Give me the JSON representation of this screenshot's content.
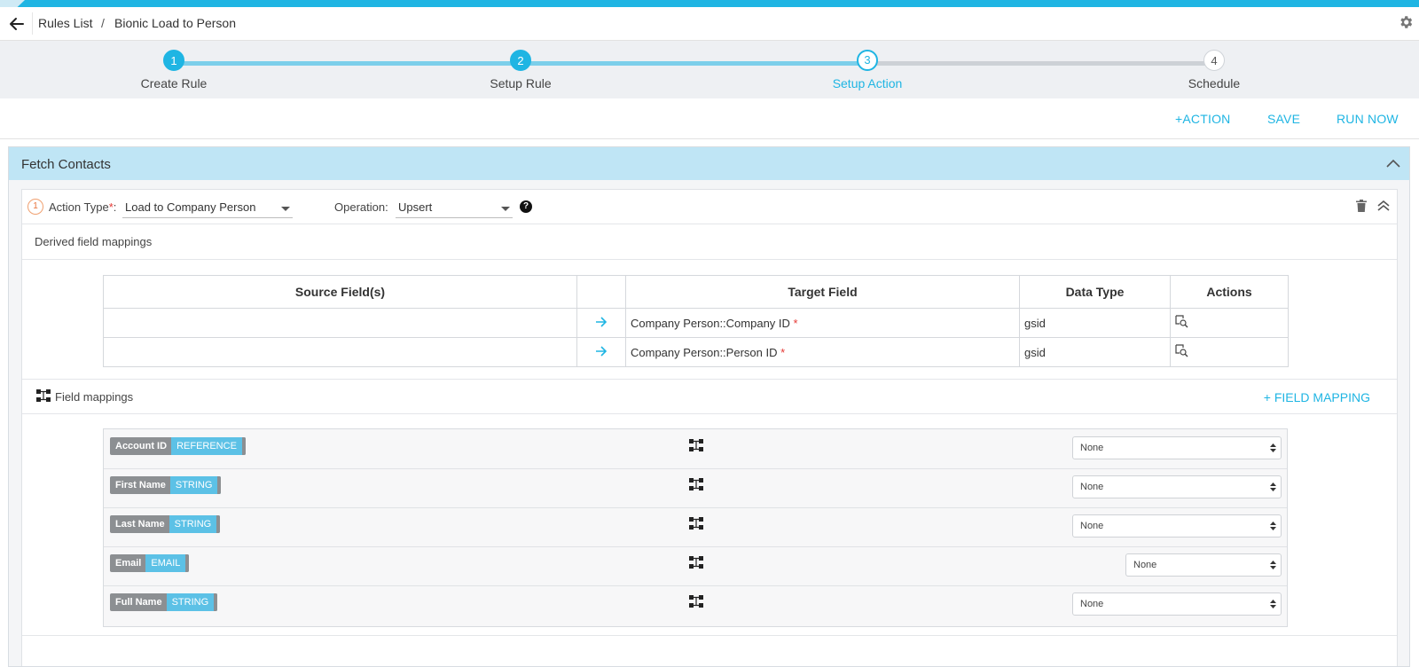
{
  "breadcrumb": {
    "parent": "Rules List",
    "separator": "/",
    "current": "Bionic Load to Person"
  },
  "stepper": {
    "steps": [
      {
        "number": "1",
        "label": "Create Rule",
        "state": "done"
      },
      {
        "number": "2",
        "label": "Setup Rule",
        "state": "done"
      },
      {
        "number": "3",
        "label": "Setup Action",
        "state": "active"
      },
      {
        "number": "4",
        "label": "Schedule",
        "state": "todo"
      }
    ]
  },
  "actions": {
    "add_action": "+ACTION",
    "save": "SAVE",
    "run_now": "RUN NOW"
  },
  "panel": {
    "title": "Fetch Contacts"
  },
  "action_config": {
    "index": "1",
    "action_type_label": "Action Type",
    "action_type_required": "*",
    "action_type_colon": ":",
    "action_type_value": "Load to Company Person",
    "operation_label": "Operation:",
    "operation_value": "Upsert",
    "help_glyph": "?"
  },
  "derived": {
    "title": "Derived field mappings",
    "columns": [
      "Source Field(s)",
      "",
      "Target Field",
      "Data Type",
      "Actions"
    ],
    "rows": [
      {
        "source": "",
        "target": "Company Person::Company ID",
        "required": "*",
        "data_type": "gsid"
      },
      {
        "source": "",
        "target": "Company Person::Person ID",
        "required": "*",
        "data_type": "gsid"
      }
    ]
  },
  "field_mappings": {
    "title": "Field mappings",
    "add_label": "+ FIELD MAPPING",
    "rows": [
      {
        "name": "Account ID",
        "type": "REFERENCE",
        "selected": "None"
      },
      {
        "name": "First Name",
        "type": "STRING",
        "selected": "None"
      },
      {
        "name": "Last Name",
        "type": "STRING",
        "selected": "None"
      },
      {
        "name": "Email",
        "type": "EMAIL",
        "selected": "None"
      },
      {
        "name": "Full Name",
        "type": "STRING",
        "selected": "None"
      }
    ]
  },
  "colors": {
    "accent": "#1fb5e3",
    "panel_header": "#bfe5f5",
    "chip_type": "#5cc1e6",
    "chip_name": "#8c8f92",
    "required": "#e53935"
  }
}
